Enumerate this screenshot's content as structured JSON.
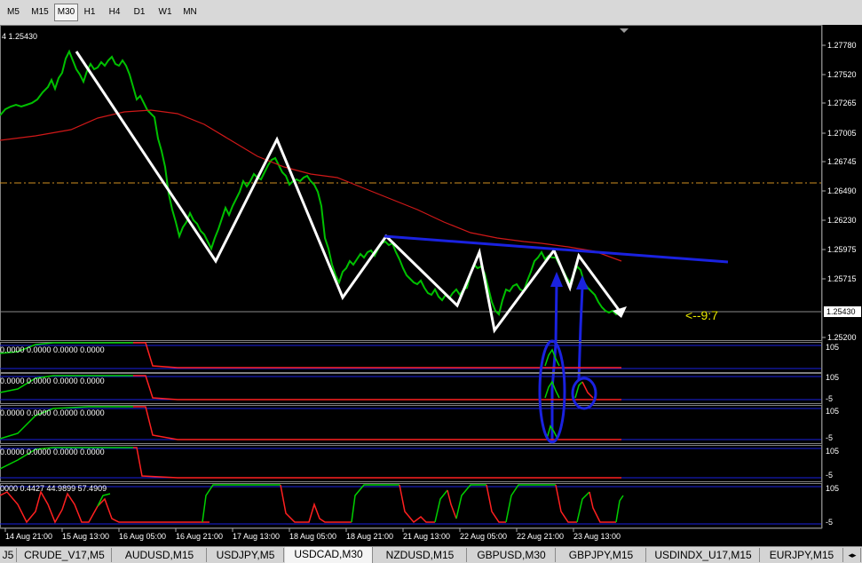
{
  "timeframes": [
    "M5",
    "M15",
    "M30",
    "H1",
    "H4",
    "D1",
    "W1",
    "MN"
  ],
  "active_timeframe": "M30",
  "chart": {
    "header_text": "4 1.25430",
    "annotation": "<--9:7",
    "current_price_label": "1.25430",
    "price_axis": [
      "1.27780",
      "1.27520",
      "1.27265",
      "1.27005",
      "1.26745",
      "1.26490",
      "1.26230",
      "1.25975",
      "1.25715",
      "1.25200"
    ],
    "time_axis": [
      "14 Aug 21:00",
      "15 Aug 13:00",
      "16 Aug 05:00",
      "16 Aug 21:00",
      "17 Aug 13:00",
      "18 Aug 05:00",
      "18 Aug 21:00",
      "21 Aug 13:00",
      "22 Aug 05:00",
      "22 Aug 21:00",
      "23 Aug 13:00"
    ]
  },
  "subwindows": [
    {
      "label": "0.0000 0.0000 0.0000 0.0000",
      "scale_top": "105",
      "scale_bottom": ""
    },
    {
      "label": "0.0000 0.0000 0.0000 0.0000",
      "scale_top": "105",
      "scale_bottom": "-5"
    },
    {
      "label": "0.0000 0.0000 0.0000 0.0000",
      "scale_top": "105",
      "scale_bottom": "-5"
    },
    {
      "label": "0.0000 0.0000 0.0000 0.0000",
      "scale_top": "105",
      "scale_bottom": "-5"
    },
    {
      "label": "0000 0.4427 44.9899 57.4909",
      "scale_top": "105",
      "scale_bottom": "-5"
    }
  ],
  "symbol_tabs": [
    "J5",
    "CRUDE_V17,M5",
    "AUDUSD,M15",
    "USDJPY,M5",
    "USDCAD,M30",
    "NZDUSD,M15",
    "GBPUSD,M30",
    "GBPJPY,M15",
    "USDINDX_U17,M15",
    "EURJPY,M15"
  ],
  "active_symbol_tab": "USDCAD,M30",
  "colors": {
    "accent_red": "#ff2020",
    "green": "#00e000",
    "blue": "#1a22e0",
    "white": "#ffffff",
    "yellow": "#e8e800",
    "orange_level": "#d09020"
  }
}
